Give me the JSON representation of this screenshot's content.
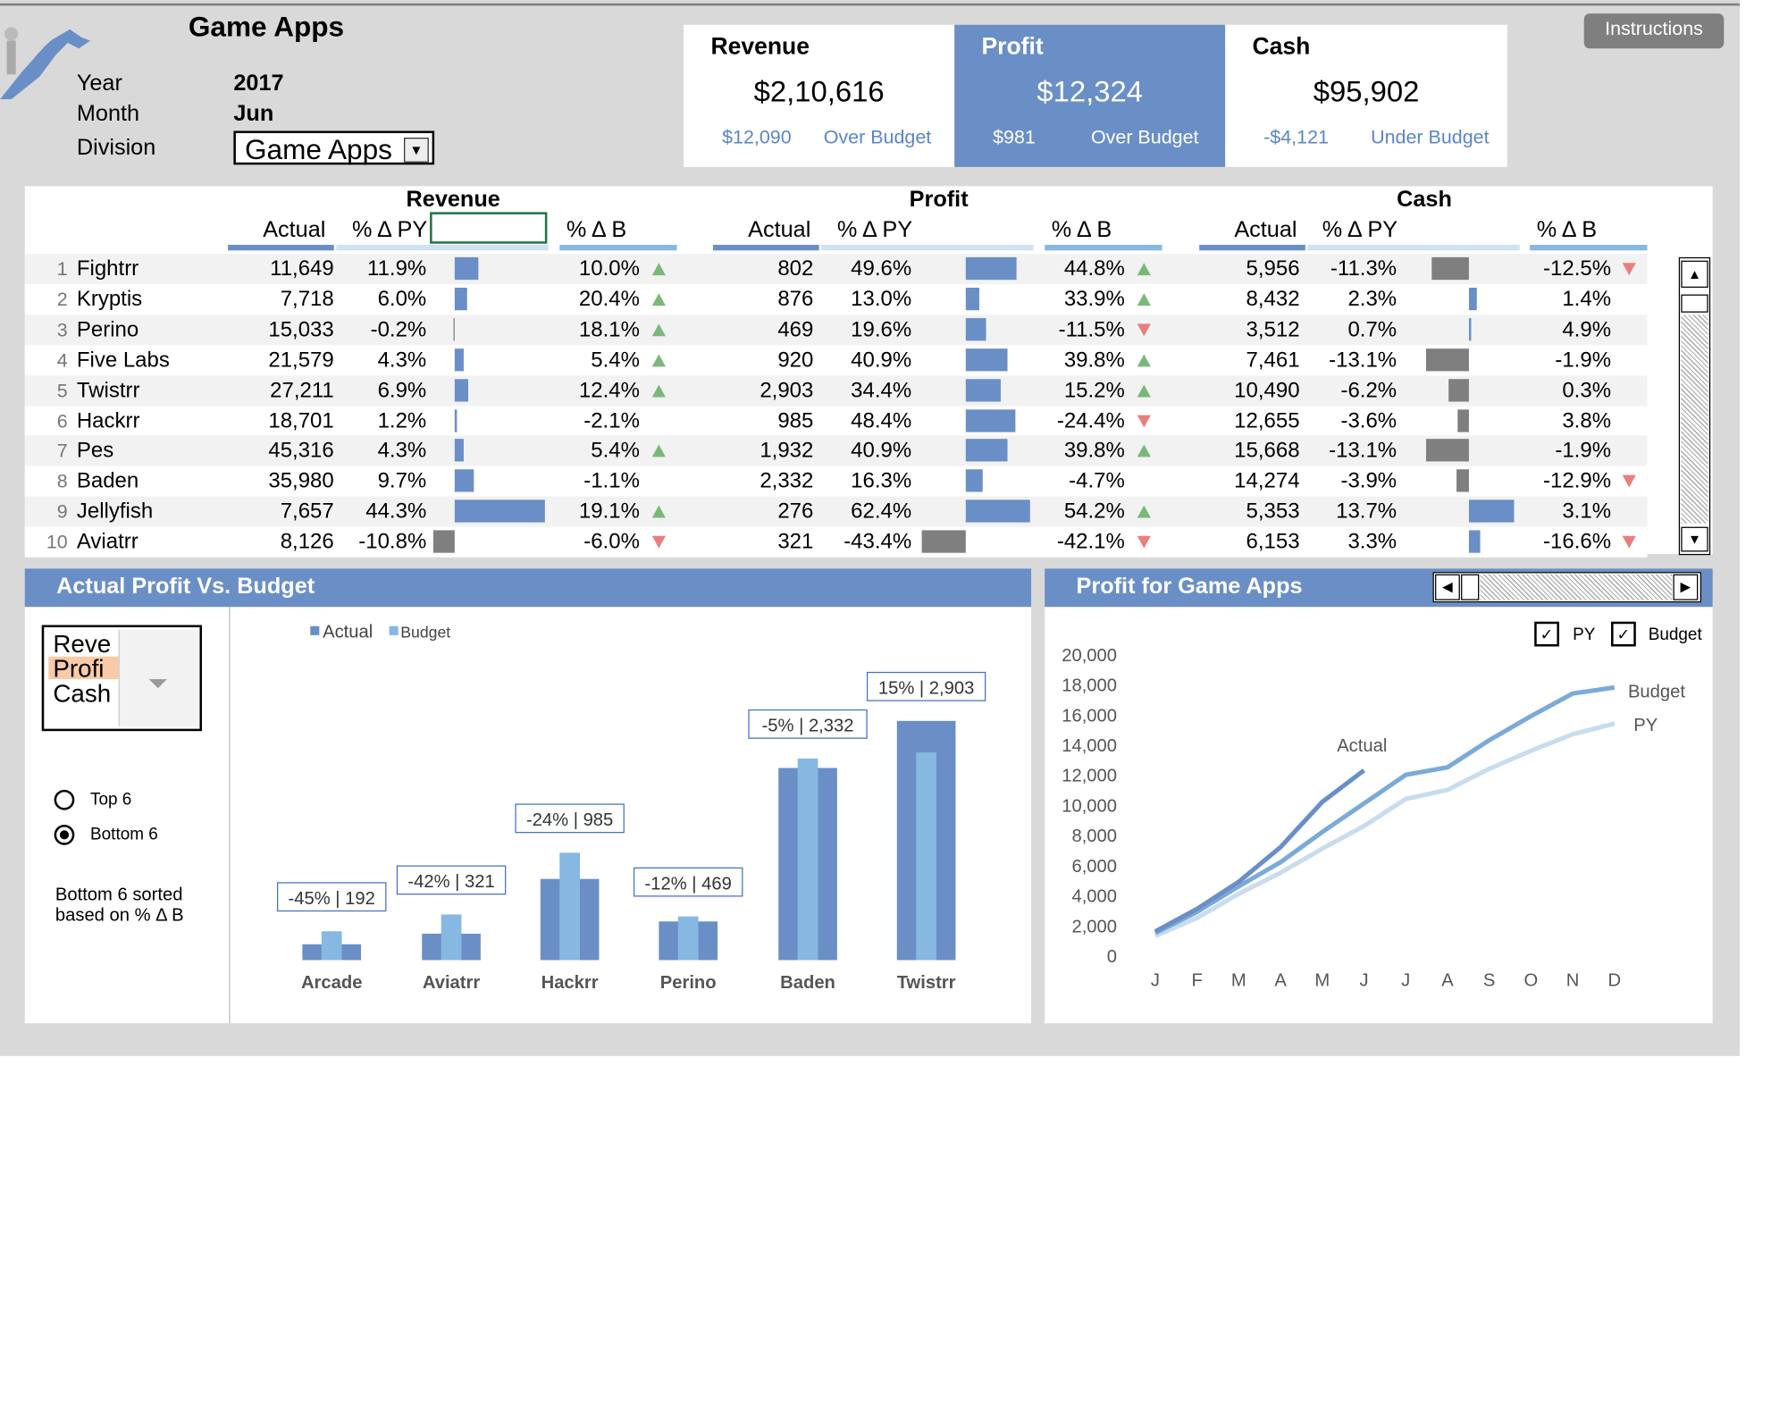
{
  "title": "Game Apps",
  "meta": {
    "year_label": "Year",
    "year_value": "2017",
    "month_label": "Month",
    "month_value": "Jun",
    "division_label": "Division",
    "division_value": "Game Apps"
  },
  "kpis": {
    "revenue": {
      "title": "Revenue",
      "value": "$2,10,616",
      "delta": "$12,090",
      "status": "Over Budget"
    },
    "profit": {
      "title": "Profit",
      "value": "$12,324",
      "delta": "$981",
      "status": "Over Budget"
    },
    "cash": {
      "title": "Cash",
      "value": "$95,902",
      "delta": "-$4,121",
      "status": "Under Budget"
    }
  },
  "instructions_label": "Instructions",
  "table": {
    "groups": [
      "Revenue",
      "Profit",
      "Cash"
    ],
    "col_actual": "Actual",
    "col_py": "% Δ PY",
    "col_b": "% Δ B",
    "rows": [
      {
        "num": "1",
        "name": "Fightrr",
        "rev": "11,649",
        "rev_py": "11.9%",
        "rev_b": "10.0%",
        "prof": "802",
        "prof_py": "49.6%",
        "prof_b": "44.8%",
        "cash": "5,956",
        "cash_py": "-11.3%",
        "cash_b": "-12.5%"
      },
      {
        "num": "2",
        "name": "Kryptis",
        "rev": "7,718",
        "rev_py": "6.0%",
        "rev_b": "20.4%",
        "prof": "876",
        "prof_py": "13.0%",
        "prof_b": "33.9%",
        "cash": "8,432",
        "cash_py": "2.3%",
        "cash_b": "1.4%"
      },
      {
        "num": "3",
        "name": "Perino",
        "rev": "15,033",
        "rev_py": "-0.2%",
        "rev_b": "18.1%",
        "prof": "469",
        "prof_py": "19.6%",
        "prof_b": "-11.5%",
        "cash": "3,512",
        "cash_py": "0.7%",
        "cash_b": "4.9%"
      },
      {
        "num": "4",
        "name": "Five Labs",
        "rev": "21,579",
        "rev_py": "4.3%",
        "rev_b": "5.4%",
        "prof": "920",
        "prof_py": "40.9%",
        "prof_b": "39.8%",
        "cash": "7,461",
        "cash_py": "-13.1%",
        "cash_b": "-1.9%"
      },
      {
        "num": "5",
        "name": "Twistrr",
        "rev": "27,211",
        "rev_py": "6.9%",
        "rev_b": "12.4%",
        "prof": "2,903",
        "prof_py": "34.4%",
        "prof_b": "15.2%",
        "cash": "10,490",
        "cash_py": "-6.2%",
        "cash_b": "0.3%"
      },
      {
        "num": "6",
        "name": "Hackrr",
        "rev": "18,701",
        "rev_py": "1.2%",
        "rev_b": "-2.1%",
        "prof": "985",
        "prof_py": "48.4%",
        "prof_b": "-24.4%",
        "cash": "12,655",
        "cash_py": "-3.6%",
        "cash_b": "3.8%"
      },
      {
        "num": "7",
        "name": "Pes",
        "rev": "45,316",
        "rev_py": "4.3%",
        "rev_b": "5.4%",
        "prof": "1,932",
        "prof_py": "40.9%",
        "prof_b": "39.8%",
        "cash": "15,668",
        "cash_py": "-13.1%",
        "cash_b": "-1.9%"
      },
      {
        "num": "8",
        "name": "Baden",
        "rev": "35,980",
        "rev_py": "9.7%",
        "rev_b": "-1.1%",
        "prof": "2,332",
        "prof_py": "16.3%",
        "prof_b": "-4.7%",
        "cash": "14,274",
        "cash_py": "-3.9%",
        "cash_b": "-12.9%"
      },
      {
        "num": "9",
        "name": "Jellyfish",
        "rev": "7,657",
        "rev_py": "44.3%",
        "rev_b": "19.1%",
        "prof": "276",
        "prof_py": "62.4%",
        "prof_b": "54.2%",
        "cash": "5,353",
        "cash_py": "13.7%",
        "cash_b": "3.1%"
      },
      {
        "num": "10",
        "name": "Aviatrr",
        "rev": "8,126",
        "rev_py": "-10.8%",
        "rev_b": "-6.0%",
        "prof": "321",
        "prof_py": "-43.4%",
        "prof_b": "-42.1%",
        "cash": "6,153",
        "cash_py": "3.3%",
        "cash_b": "-16.6%"
      }
    ],
    "indicators": {
      "rev": [
        "up",
        "up",
        "up",
        "up",
        "up",
        "none",
        "up",
        "none",
        "up",
        "down"
      ],
      "prof": [
        "up",
        "up",
        "down",
        "up",
        "up",
        "down",
        "up",
        "none",
        "up",
        "down"
      ],
      "cash": [
        "down",
        "none",
        "none",
        "none",
        "none",
        "none",
        "none",
        "down",
        "none",
        "down"
      ]
    },
    "bars": {
      "rev_py": [
        11.9,
        6.0,
        -0.2,
        4.3,
        6.9,
        1.2,
        4.3,
        9.7,
        44.3,
        -10.8
      ],
      "prof_py": [
        49.6,
        13.0,
        19.6,
        40.9,
        34.4,
        48.4,
        40.9,
        16.3,
        62.4,
        -43.4
      ],
      "cash_py": [
        -11.3,
        2.3,
        0.7,
        -13.1,
        -6.2,
        -3.6,
        -13.1,
        -3.9,
        13.7,
        3.3
      ]
    }
  },
  "left_panel": {
    "title": "Actual Profit Vs. Budget",
    "listbox_items": [
      "Reve",
      "Profi",
      "Cash"
    ],
    "radio_top": "Top 6",
    "radio_bottom": "Bottom 6",
    "note": "Bottom 6 sorted based on % Δ B"
  },
  "right_panel": {
    "title": "Profit for Game Apps",
    "check_py": "PY",
    "check_budget": "Budget"
  },
  "chart_data": [
    {
      "type": "bar",
      "legend": [
        "Actual",
        "Budget"
      ],
      "categories": [
        "Arcade",
        "Aviatrr",
        "Hackrr",
        "Perino",
        "Baden",
        "Twistrr"
      ],
      "series": [
        {
          "name": "Actual",
          "values": [
            192,
            321,
            985,
            469,
            2332,
            2903
          ]
        },
        {
          "name": "Budget",
          "values": [
            350,
            554,
            1303,
            530,
            2447,
            2520
          ]
        }
      ],
      "data_labels": [
        "-45% | 192",
        "-42% | 321",
        "-24% | 985",
        "-12% | 469",
        "-5% | 2,332",
        "15% | 2,903"
      ],
      "colors": {
        "Actual": "#6a8fc6",
        "Budget": "#86b8e2"
      }
    },
    {
      "type": "line",
      "x": [
        "J",
        "F",
        "M",
        "A",
        "M",
        "J",
        "J",
        "A",
        "S",
        "O",
        "N",
        "D"
      ],
      "ylim": [
        0,
        20000
      ],
      "yticks": [
        "0",
        "2,000",
        "4,000",
        "6,000",
        "8,000",
        "10,000",
        "12,000",
        "14,000",
        "16,000",
        "18,000",
        "20,000"
      ],
      "series": [
        {
          "name": "Actual",
          "values": [
            1600,
            3100,
            4900,
            7200,
            10200,
            12300
          ],
          "color": "#6a8fc6"
        },
        {
          "name": "Budget",
          "values": [
            1500,
            2900,
            4600,
            6200,
            8200,
            10100,
            12000,
            12500,
            14300,
            15900,
            17400,
            17800
          ],
          "color": "#7aaad8"
        },
        {
          "name": "PY",
          "values": [
            1300,
            2500,
            4100,
            5500,
            7100,
            8600,
            10400,
            11000,
            12400,
            13600,
            14700,
            15400
          ],
          "color": "#c7dcef"
        }
      ]
    }
  ]
}
